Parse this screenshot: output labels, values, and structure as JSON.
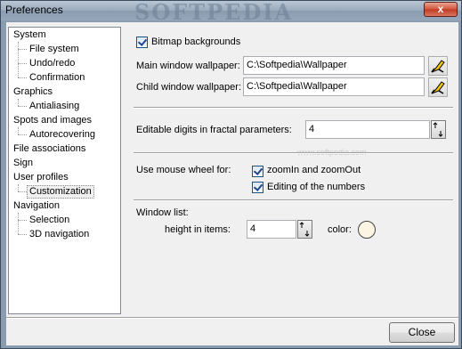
{
  "window": {
    "title": "Preferences",
    "watermark": "SOFTPEDIA",
    "close_glyph": "x"
  },
  "tree": {
    "items": [
      {
        "label": "System",
        "level": 0
      },
      {
        "label": "File system",
        "level": 1
      },
      {
        "label": "Undo/redo",
        "level": 1
      },
      {
        "label": "Confirmation",
        "level": 1
      },
      {
        "label": "Graphics",
        "level": 0
      },
      {
        "label": "Antialiasing",
        "level": 1
      },
      {
        "label": "Spots and images",
        "level": 0
      },
      {
        "label": "Autorecovering",
        "level": 1
      },
      {
        "label": "File associations",
        "level": 0
      },
      {
        "label": "Sign",
        "level": 0
      },
      {
        "label": "User profiles",
        "level": 0
      },
      {
        "label": "Customization",
        "level": 1,
        "selected": true
      },
      {
        "label": "Navigation",
        "level": 0
      },
      {
        "label": "Selection",
        "level": 1
      },
      {
        "label": "3D navigation",
        "level": 1
      }
    ]
  },
  "panel": {
    "bitmap_backgrounds": {
      "label": "Bitmap backgrounds",
      "checked": true
    },
    "main_wallpaper": {
      "label": "Main window wallpaper:",
      "value": "C:\\Softpedia\\Wallpaper"
    },
    "child_wallpaper": {
      "label": "Child window wallpaper:",
      "value": "C:\\Softpedia\\Wallpaper"
    },
    "editable_digits": {
      "label": "Editable digits in fractal parameters:",
      "value": "4"
    },
    "center_watermark": "www.softpedia.com",
    "mouse_wheel": {
      "label": "Use mouse wheel for:",
      "zoom": {
        "label": "zoomIn and zoomOut",
        "checked": true
      },
      "editing": {
        "label": "Editing of the numbers",
        "checked": true
      }
    },
    "window_list": {
      "label": "Window list:",
      "height_label": "height in items:",
      "height_value": "4",
      "color_label": "color:",
      "color": "#fcf5e4"
    }
  },
  "footer": {
    "close_label": "Close"
  }
}
